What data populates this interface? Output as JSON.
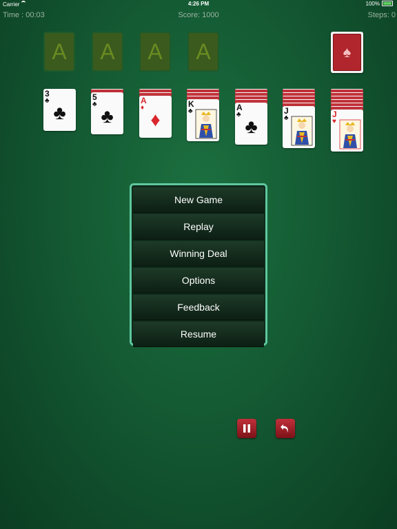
{
  "status_bar": {
    "carrier": "Carrier",
    "time": "4:26 PM",
    "battery": "100%"
  },
  "info": {
    "time": "Time : 00:03",
    "score": "Score:  1000",
    "steps": "Steps:   0"
  },
  "foundations": [
    "A",
    "A",
    "A",
    "A"
  ],
  "tableau": [
    {
      "rank": "3",
      "suit": "♣",
      "color": "black",
      "face": false,
      "down": 0
    },
    {
      "rank": "5",
      "suit": "♣",
      "color": "black",
      "face": false,
      "down": 1
    },
    {
      "rank": "A",
      "suit": "♦",
      "color": "red",
      "face": false,
      "down": 2
    },
    {
      "rank": "K",
      "suit": "♣",
      "color": "black",
      "face": true,
      "down": 3
    },
    {
      "rank": "A",
      "suit": "♣",
      "color": "black",
      "face": false,
      "down": 4
    },
    {
      "rank": "J",
      "suit": "♣",
      "color": "black",
      "face": true,
      "down": 5
    },
    {
      "rank": "J",
      "suit": "♥",
      "color": "red",
      "face": true,
      "down": 6
    }
  ],
  "menu": [
    "New Game",
    "Replay",
    "Winning Deal",
    "Options",
    "Feedback",
    "Resume"
  ],
  "buttons": {
    "pause": "pause-icon",
    "undo": "undo-icon"
  },
  "colors": {
    "menu_border": "#5fc7a0",
    "button": "#b02630",
    "card_back": "#b0262c"
  }
}
